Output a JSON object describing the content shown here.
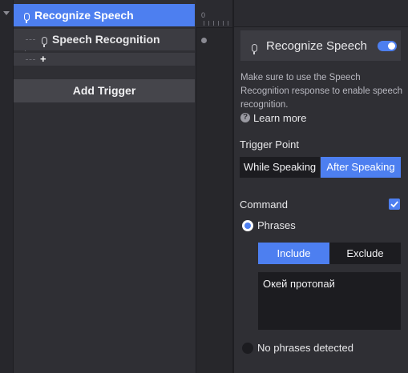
{
  "tree": {
    "root_label": "Recognize Speech",
    "child_label": "Speech Recognition",
    "add_child_symbol": "+",
    "add_trigger_label": "Add Trigger"
  },
  "timeline": {
    "start_label": "0"
  },
  "panel": {
    "title": "Recognize Speech",
    "enabled": true,
    "description": "Make sure to use the Speech Recognition response to enable speech recognition.",
    "learn_more_label": "Learn more",
    "trigger_point": {
      "label": "Trigger Point",
      "options": [
        "While Speaking",
        "After Speaking"
      ],
      "selected": "After Speaking"
    },
    "command": {
      "label": "Command",
      "checked": true
    },
    "phrases": {
      "radio_label": "Phrases",
      "selected": true,
      "filter_options": [
        "Include",
        "Exclude"
      ],
      "filter_selected": "Include",
      "value": "Окей протопай"
    },
    "no_phrases": {
      "radio_label": "No phrases detected",
      "selected": false
    }
  },
  "colors": {
    "accent": "#4d7ff0",
    "panel_bg": "#2f2f34",
    "field_bg": "#1c1c20"
  }
}
